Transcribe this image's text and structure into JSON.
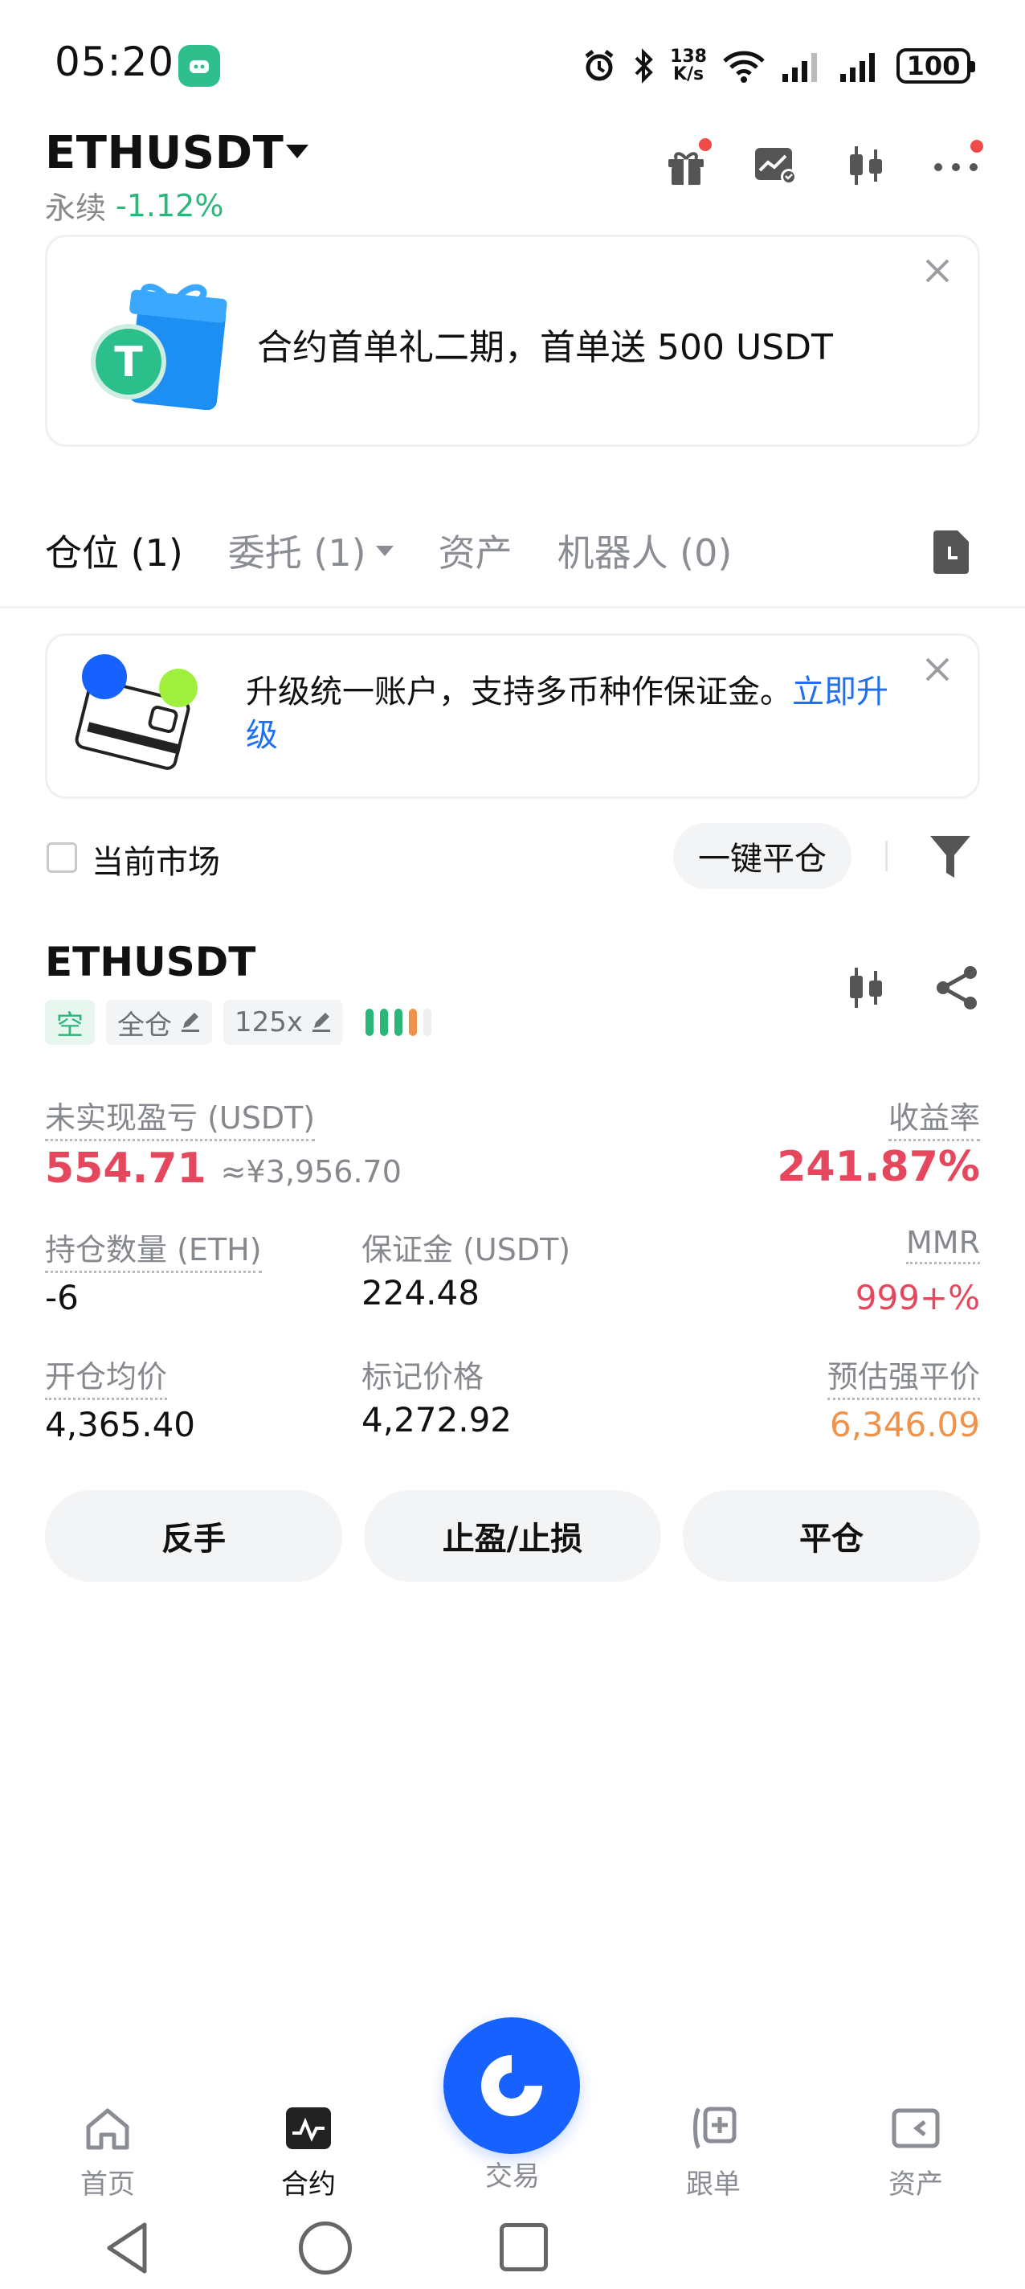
{
  "status_bar": {
    "time": "05:20",
    "net_speed_top": "138",
    "net_speed_bottom": "K/s",
    "battery": "100"
  },
  "header": {
    "pair": "ETHUSDT",
    "perp_label": "永续",
    "change": "-1.12%"
  },
  "promo_banner": {
    "text": "合约首单礼二期，首单送 500 USDT"
  },
  "tabs": [
    {
      "label": "仓位 (1)",
      "active": true
    },
    {
      "label": "委托 (1)",
      "active": false
    },
    {
      "label": "资产",
      "active": false
    },
    {
      "label": "机器人 (0)",
      "active": false
    }
  ],
  "upgrade_banner": {
    "text": "升级统一账户，支持多币种作保证金。",
    "link": "立即升级"
  },
  "filter": {
    "current_market_label": "当前市场",
    "close_all_label": "一键平仓"
  },
  "position": {
    "symbol": "ETHUSDT",
    "side_tag": "空",
    "margin_mode_tag": "全仓",
    "leverage_tag": "125x",
    "risk_level": 4,
    "unrealized_pnl_label": "未实现盈亏 (USDT)",
    "unrealized_pnl": "554.71",
    "unrealized_pnl_cny": "≈¥3,956.70",
    "roe_label": "收益率",
    "roe": "241.87%",
    "qty_label": "持仓数量 (ETH)",
    "qty": "-6",
    "margin_label": "保证金 (USDT)",
    "margin": "224.48",
    "mmr_label": "MMR",
    "mmr": "999+%",
    "entry_label": "开仓均价",
    "entry": "4,365.40",
    "mark_label": "标记价格",
    "mark": "4,272.92",
    "liq_label": "预估强平价",
    "liq": "6,346.09",
    "colors": {
      "loss_red": "#e5475d",
      "gain_green": "#2bb67a",
      "liq_orange": "#f0924a"
    }
  },
  "actions": {
    "reverse": "反手",
    "tpsl": "止盈/止损",
    "close": "平仓"
  },
  "bottom_nav": [
    {
      "label": "首页",
      "icon": "home-icon"
    },
    {
      "label": "合约",
      "icon": "contract-icon",
      "active": true
    },
    {
      "label": "交易",
      "icon": "trade-icon"
    },
    {
      "label": "跟单",
      "icon": "copy-trade-icon"
    },
    {
      "label": "资产",
      "icon": "wallet-icon"
    }
  ]
}
